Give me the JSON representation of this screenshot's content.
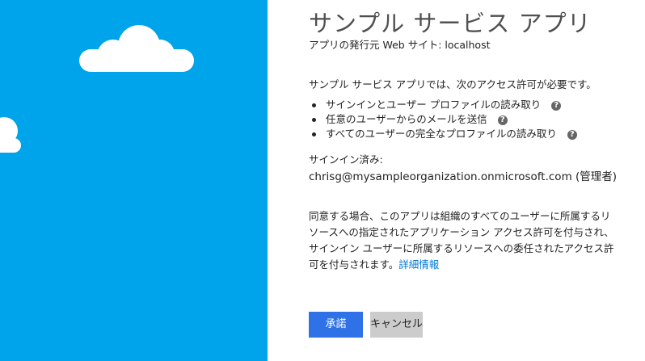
{
  "consent_page": {
    "app_name": "サンプル サービス アプリ",
    "publisher": "アプリの発行元 Web サイト: localhost",
    "request_intro": "サンプル サービス アプリでは、次のアクセス許可が必要です。",
    "permissions": [
      {
        "label": "サインインとユーザー プロファイルの読み取り",
        "help_icon": "question-mark-icon"
      },
      {
        "label": "任意のユーザーからのメールを送信",
        "help_icon": "question-mark-icon"
      },
      {
        "label": "すべてのユーザーの完全なプロファイルの読み取り",
        "help_icon": "question-mark-icon"
      }
    ],
    "signed_in_label": "サインイン済み:",
    "signed_in_user": "chrisg@mysampleorganization.onmicrosoft.com (管理者)",
    "consent_lines": [
      "同意する場合、このアプリは組織のすべてのユーザーに所属するリ",
      "ソースへの指定されたアプリケーション アクセス許可を付与され、",
      "サインイン ユーザーに所属するリソースへの委任されたアクセス許",
      "可を付与されます。"
    ],
    "details_link": "詳細情報",
    "accept_label": "承諾",
    "cancel_label": "キャンセル",
    "help_glyph": "?"
  },
  "theme": {
    "left_panel_color": "#00a4ea",
    "cloud_color": "#ffffff",
    "accept_button_color": "#2f72e8",
    "cancel_button_color": "#cccccc",
    "link_color": "#0078d7"
  }
}
